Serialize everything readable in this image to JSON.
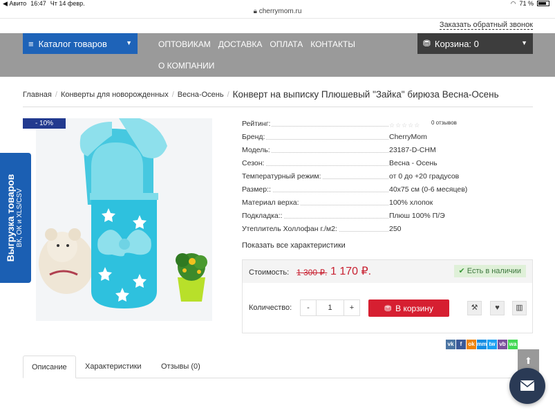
{
  "status": {
    "back_app": "Авито",
    "time": "16:47",
    "date": "Чт 14 февр.",
    "battery": "71 %"
  },
  "browser": {
    "url": "cherrymom.ru"
  },
  "header": {
    "callback": "Заказать обратный звонок"
  },
  "nav": {
    "catalog": "Каталог товаров",
    "links": [
      "ОПТОВИКАМ",
      "ДОСТАВКА",
      "ОПЛАТА",
      "КОНТАКТЫ"
    ],
    "about": "О КОМПАНИИ",
    "cart": "Корзина: 0"
  },
  "breadcrumb": {
    "items": [
      "Главная",
      "Конверты для новорожденных",
      "Весна-Осень"
    ],
    "current": "Конверт на выписку Плюшевый \"Зайка\" бирюза Весна-Осень"
  },
  "product": {
    "discount": "- 10%",
    "reviews": "0 отзывов",
    "specs": [
      {
        "k": "Рейтинг:",
        "v": ""
      },
      {
        "k": "Бренд:",
        "v": "CherryMom"
      },
      {
        "k": "Модель:",
        "v": "23187-D-CHM"
      },
      {
        "k": "Сезон:",
        "v": "Весна - Осень"
      },
      {
        "k": "Температурный режим:",
        "v": "от 0 до +20 градусов"
      },
      {
        "k": "Размер::",
        "v": "40x75 см (0-6 месяцев)"
      },
      {
        "k": "Материал верха:",
        "v": "100% хлопок"
      },
      {
        "k": "Подкладка::",
        "v": "Плюш 100% П/Э"
      },
      {
        "k": "Утеплитель Холлофан г./м2:",
        "v": "250"
      }
    ],
    "show_all": "Показать все характеристики",
    "cost_label": "Стоимость:",
    "old_price": "1 300 ₽.",
    "new_price": "1 170 ₽.",
    "in_stock": "Есть в наличии",
    "qty_label": "Количество:",
    "qty": "1",
    "minus": "-",
    "plus": "+",
    "add_to_cart": "В корзину"
  },
  "export_tab": {
    "line1": "Выгрузка товаров",
    "line2": "ВК, ОК и XLS/CSV"
  },
  "social": [
    "vk",
    "f",
    "ok",
    "mm",
    "tw",
    "vb",
    "wa"
  ],
  "tabs": [
    "Описание",
    "Характеристики",
    "Отзывы (0)"
  ],
  "colors": {
    "brand_blue": "#1e63b8",
    "red": "#d61f31",
    "nav_gray": "#9a9a9a",
    "dark": "#3d3d3d"
  }
}
